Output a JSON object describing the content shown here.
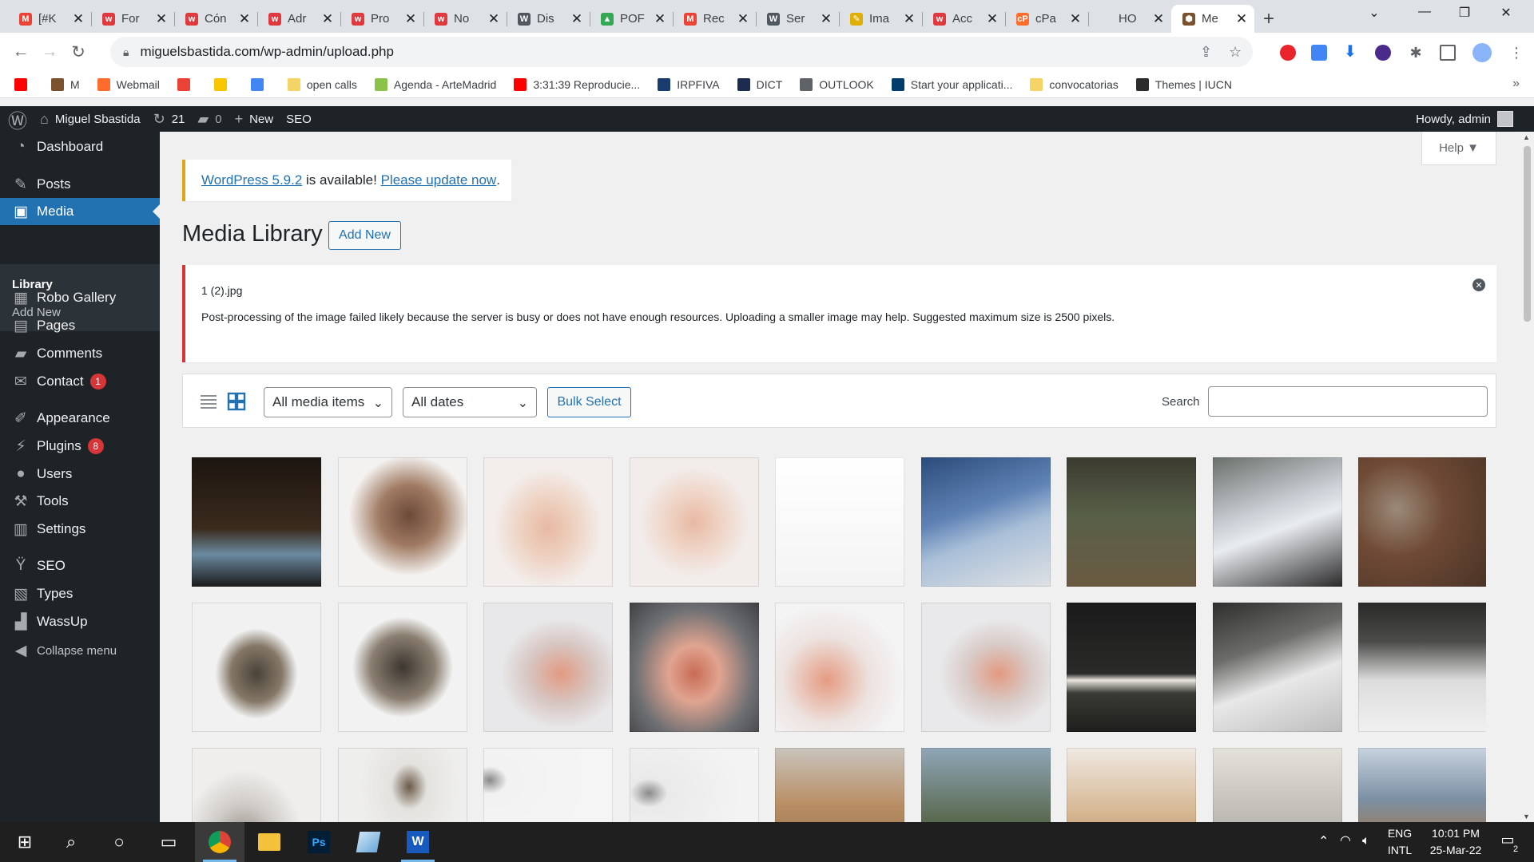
{
  "browser": {
    "tabs": [
      {
        "label": "[#K",
        "icon": "gmail-icon",
        "color": "#ea4335",
        "letter": "M"
      },
      {
        "label": "For",
        "icon": "wix-icon",
        "color": "#e03a3e",
        "letter": "w"
      },
      {
        "label": "Cón",
        "icon": "wix-icon",
        "color": "#e03a3e",
        "letter": "w"
      },
      {
        "label": "Adr",
        "icon": "wix-icon",
        "color": "#e03a3e",
        "letter": "w"
      },
      {
        "label": "Pro",
        "icon": "wix-icon",
        "color": "#e03a3e",
        "letter": "w"
      },
      {
        "label": "No",
        "icon": "wix-icon",
        "color": "#e03a3e",
        "letter": "w"
      },
      {
        "label": "Dis",
        "icon": "wordpress-icon",
        "color": "#50575e",
        "letter": "W"
      },
      {
        "label": "POF",
        "icon": "google-drive-icon",
        "color": "#34a853",
        "letter": "▲"
      },
      {
        "label": "Rec",
        "icon": "gmail-icon",
        "color": "#ea4335",
        "letter": "M"
      },
      {
        "label": "Ser",
        "icon": "wordpress-icon",
        "color": "#50575e",
        "letter": "W"
      },
      {
        "label": "Ima",
        "icon": "pencil-icon",
        "color": "#e0b000",
        "letter": "✎"
      },
      {
        "label": "Acc",
        "icon": "wix-icon",
        "color": "#e03a3e",
        "letter": "w"
      },
      {
        "label": "cPa",
        "icon": "cpanel-icon",
        "color": "#ff6c2c",
        "letter": "cP"
      },
      {
        "label": "HO",
        "icon": "blank-page-icon",
        "color": "#dee1e6",
        "letter": ""
      },
      {
        "label": "Me",
        "icon": "site-favicon-icon",
        "color": "#7a5230",
        "letter": "⬢",
        "active": true
      }
    ],
    "url": "miguelsbastida.com/wp-admin/upload.php",
    "bookmarks": [
      {
        "label": "",
        "icon": "youtube-icon",
        "color": "#ff0000"
      },
      {
        "label": "M",
        "icon": "site-favicon-icon",
        "color": "#7a5230"
      },
      {
        "label": "Webmail",
        "icon": "cpanel-icon",
        "color": "#ff6c2c"
      },
      {
        "label": "",
        "icon": "gmail-icon",
        "color": "#ea4335"
      },
      {
        "label": "",
        "icon": "coin-icon",
        "color": "#f7c600"
      },
      {
        "label": "",
        "icon": "google-icon",
        "color": "#4285f4"
      },
      {
        "label": "open calls",
        "icon": "folder-icon",
        "color": "#f6d365"
      },
      {
        "label": "Agenda - ArteMadrid",
        "icon": "page-icon",
        "color": "#8bc34a"
      },
      {
        "label": "3:31:39 Reproducie...",
        "icon": "youtube-icon",
        "color": "#ff0000"
      },
      {
        "label": "IRPFIVA",
        "icon": "ds-icon",
        "color": "#1a3b6e"
      },
      {
        "label": "DICT",
        "icon": "dict-icon",
        "color": "#1d2b4f"
      },
      {
        "label": "OUTLOOK",
        "icon": "globe-icon",
        "color": "#5f6368"
      },
      {
        "label": "Start your applicati...",
        "icon": "ucsc-icon",
        "color": "#003c6c"
      },
      {
        "label": "convocatorias",
        "icon": "folder-icon",
        "color": "#f6d365"
      },
      {
        "label": "Themes | IUCN",
        "icon": "iucn-icon",
        "color": "#2c2c2c"
      }
    ],
    "more_bookmarks": "»"
  },
  "adminbar": {
    "site_name": "Miguel Sbastida",
    "updates_count": "21",
    "comments_count": "0",
    "new_label": "New",
    "seo_label": "SEO",
    "howdy": "Howdy, admin"
  },
  "sidebar": {
    "items": [
      {
        "label": "Dashboard",
        "icon": "dashboard-icon",
        "glyph": "◔"
      },
      {
        "label": "Posts",
        "icon": "pushpin-icon",
        "glyph": "✎"
      },
      {
        "label": "Media",
        "icon": "media-icon",
        "glyph": "▣",
        "current": true
      },
      {
        "label": "Robo Gallery",
        "icon": "robo-gallery-icon",
        "glyph": "▦"
      },
      {
        "label": "Pages",
        "icon": "pages-icon",
        "glyph": "▤"
      },
      {
        "label": "Comments",
        "icon": "comments-icon",
        "glyph": "▰"
      },
      {
        "label": "Contact",
        "icon": "mail-icon",
        "glyph": "✉",
        "badge": "1"
      },
      {
        "label": "Appearance",
        "icon": "paintbrush-icon",
        "glyph": "✐"
      },
      {
        "label": "Plugins",
        "icon": "plugins-icon",
        "glyph": "⚡",
        "badge": "8"
      },
      {
        "label": "Users",
        "icon": "users-icon",
        "glyph": "●"
      },
      {
        "label": "Tools",
        "icon": "tools-icon",
        "glyph": "⚒"
      },
      {
        "label": "Settings",
        "icon": "settings-icon",
        "glyph": "▥"
      },
      {
        "label": "SEO",
        "icon": "seo-icon",
        "glyph": "Ÿ"
      },
      {
        "label": "Types",
        "icon": "types-icon",
        "glyph": "▧"
      },
      {
        "label": "WassUp",
        "icon": "wassup-icon",
        "glyph": "▟"
      },
      {
        "label": "Collapse menu",
        "icon": "collapse-icon",
        "glyph": "◀"
      }
    ],
    "submenu": {
      "library": "Library",
      "add_new": "Add New"
    }
  },
  "main": {
    "help_label": "Help ▼",
    "update_nag": {
      "link1": "WordPress 5.9.2",
      "middle": " is available! ",
      "link2": "Please update now",
      "end": "."
    },
    "title": "Media Library",
    "add_new": "Add New",
    "error": {
      "filename": "1 (2).jpg",
      "message": "Post-processing of the image failed likely because the server is busy or does not have enough resources. Uploading a smaller image may help. Suggested maximum size is 2500 pixels."
    },
    "filters": {
      "type_select": "All media items",
      "date_select": "All dates",
      "bulk_select": "Bulk Select",
      "search_label": "Search",
      "search_value": ""
    },
    "thumbnails": [
      {
        "desc": "dark-gallery-installation",
        "bg": "linear-gradient(180deg,#1c1510 0%,#3a2a1c 55%,#6b8aa0 75%,#1a1a1a 100%)"
      },
      {
        "desc": "portrait-woman",
        "bg": "radial-gradient(ellipse at 55% 45%,#6b4a3a 0%,#a07a62 30%,#f4f2f0 60%)"
      },
      {
        "desc": "hand-bracelet",
        "bg": "radial-gradient(ellipse at 50% 55%,#e8b9a3 0%,#eed2c2 30%,#f3eeec 60%)"
      },
      {
        "desc": "hand-rings",
        "bg": "radial-gradient(ellipse at 50% 50%,#e8b9a3 0%,#efd4c6 30%,#f2ecea 60%)"
      },
      {
        "desc": "diagram-document",
        "bg": "linear-gradient(180deg,#ffffff 0%,#f4f4f4 100%)"
      },
      {
        "desc": "water-rock",
        "bg": "linear-gradient(160deg,#2b4c7a 0%,#5f82b5 40%,#a9bfd8 60%,#dfe1e4 100%)"
      },
      {
        "desc": "forest",
        "bg": "linear-gradient(180deg,#3b3a2f 0%,#586048 45%,#6b5a42 100%)"
      },
      {
        "desc": "plastic-sheet-feet",
        "bg": "linear-gradient(160deg,#6b6f6a 0%,#c9ced4 40%,#e9ecef 55%,#2a2a2a 100%)"
      },
      {
        "desc": "leaves-ground",
        "bg": "radial-gradient(circle at 30% 40%,#9b8a78 0%,#6f4a36 40%,#4a3325 100%)"
      },
      {
        "desc": "stone-box-closed",
        "bg": "radial-gradient(ellipse at 50% 55%,#4a4238 0%,#857868 28%,#f1f1f1 45%)"
      },
      {
        "desc": "stone-box-open",
        "bg": "radial-gradient(ellipse at 50% 50%,#3d3730 0%,#8a7e70 35%,#f2f2f2 55%)"
      },
      {
        "desc": "salt-rocks-steps",
        "bg": "radial-gradient(ellipse at 60% 55%,#e29a82 0%,#d7c6c2 30%,#e8e8ea 55%)"
      },
      {
        "desc": "salt-rock-closeup",
        "bg": "radial-gradient(ellipse at 50% 55%,#c96b55 0%,#e0a490 28%,#6d6f73 65%,#3e4044 100%)"
      },
      {
        "desc": "salt-rocks-field",
        "bg": "radial-gradient(ellipse at 40% 60%,#e59b82 0%,#ede3e0 40%,#f4f4f5 70%)"
      },
      {
        "desc": "salt-rocks-steps-2",
        "bg": "radial-gradient(ellipse at 60% 55%,#e29a82 0%,#d9cbc8 30%,#e9e9eb 55%)"
      },
      {
        "desc": "dark-hall-installation",
        "bg": "linear-gradient(180deg,#1a1a1a 0%,#2a2a28 55%,#e9e6de 60%,#3a3a36 70%,#1e1e1c 100%)"
      },
      {
        "desc": "white-steps-hall",
        "bg": "linear-gradient(160deg,#2e2e2c 0%,#6c6c6a 35%,#e8e8e8 60%,#bdbdbd 100%)"
      },
      {
        "desc": "white-steps-long",
        "bg": "linear-gradient(180deg,#2a2a28 0%,#4b4b49 30%,#dcdcdc 60%,#f0f0f0 100%)"
      },
      {
        "desc": "stone-on-white",
        "bg": "radial-gradient(ellipse at 40% 75%,#8d8478 0%,#cfccc8 30%,#efeeec 55%)"
      },
      {
        "desc": "small-stone",
        "bg": "radial-gradient(ellipse at 55% 30%,#6b5a48 0%,#e4e2df 18%,#eeeeec 50%)"
      },
      {
        "desc": "tiny-stone-white",
        "bg": "radial-gradient(ellipse at 5% 25%,#8a8a8a 0%,#f2f2f2 10%,#f5f5f5 60%)"
      },
      {
        "desc": "tiny-stone-2",
        "bg": "radial-gradient(ellipse at 15% 35%,#8a8a8a 0%,#eaeaea 12%,#f3f3f3 60%)"
      },
      {
        "desc": "wooden-structure",
        "bg": "linear-gradient(180deg,#c9c4bd 0%,#b88d62 45%,#8a6a4a 100%)"
      },
      {
        "desc": "tree-plastic-bottles",
        "bg": "linear-gradient(180deg,#8fa6b8 0%,#5b6b52 55%,#3e4a3a 100%)"
      },
      {
        "desc": "wooden-table-objects",
        "bg": "linear-gradient(180deg,#efe9e3 0%,#d6b792 50%,#a8825c 100%)"
      },
      {
        "desc": "white-cloth-sculpture",
        "bg": "linear-gradient(180deg,#e5e2dc 0%,#bdbab4 55%,#8fa7c2 100%)"
      },
      {
        "desc": "waterfall-cliff",
        "bg": "linear-gradient(180deg,#c7d3df 0%,#7c8fa3 40%,#a3784d 75%,#5b4631 100%)"
      }
    ]
  },
  "taskbar": {
    "lang_top": "ENG",
    "lang_bottom": "INTL",
    "time": "10:01 PM",
    "date": "25-Mar-22",
    "notifications": "2"
  }
}
